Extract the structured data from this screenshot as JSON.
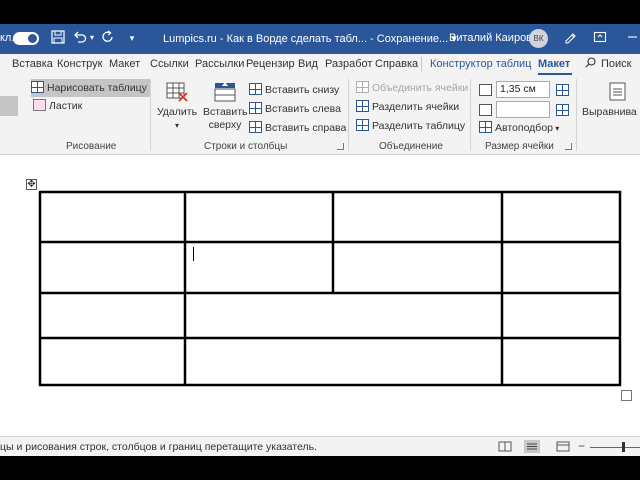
{
  "titlebar": {
    "autosave_label": "кл.",
    "doc_title": "Lumpics.ru - Как в Ворде сделать табл...  -  Сохранение... ▾",
    "user_name": "Виталий Каиров",
    "user_initials": "ВК"
  },
  "tabs": [
    "Вставка",
    "Конструк",
    "Макет",
    "Ссылки",
    "Рассылки",
    "Рецензир",
    "Вид",
    "Разработ",
    "Справка",
    "Конструктор таблиц",
    "Макет",
    "Поиск"
  ],
  "active_tab": "Макет",
  "ribbon": {
    "draw": {
      "draw_table": "Нарисовать таблицу",
      "eraser": "Ластик",
      "label": "Рисование"
    },
    "rows_cols": {
      "delete": "Удалить",
      "insert_above_1": "Вставить",
      "insert_above_2": "сверху",
      "insert_below": "Вставить снизу",
      "insert_left": "Вставить слева",
      "insert_right": "Вставить справа",
      "label": "Строки и столбцы"
    },
    "merge": {
      "merge_cells": "Объединить ячейки",
      "split_cells": "Разделить ячейки",
      "split_table": "Разделить таблицу",
      "label": "Объединение"
    },
    "cell_size": {
      "height_value": "1,35 см",
      "width_value": "",
      "autofit": "Автоподбор",
      "label": "Размер ячейки"
    },
    "alignment": {
      "label": "Выравнива"
    }
  },
  "status": {
    "text": "цы и рисования строк, столбцов и границ перетащите указатель."
  },
  "table": {
    "rows": [
      {
        "cells": [
          {
            "colspan": 1,
            "text": ""
          },
          {
            "colspan": 1,
            "text": ""
          },
          {
            "colspan": 1,
            "text": ""
          },
          {
            "colspan": 1,
            "text": ""
          }
        ]
      },
      {
        "cells": [
          {
            "colspan": 1,
            "text": ""
          },
          {
            "colspan": 1,
            "text": ""
          },
          {
            "colspan": 1,
            "text": ""
          },
          {
            "colspan": 1,
            "text": ""
          }
        ]
      },
      {
        "cells": [
          {
            "colspan": 1,
            "text": ""
          },
          {
            "colspan": 2,
            "text": ""
          },
          {
            "colspan": 1,
            "text": ""
          }
        ]
      },
      {
        "cells": [
          {
            "colspan": 1,
            "text": ""
          },
          {
            "colspan": 2,
            "text": ""
          },
          {
            "colspan": 1,
            "text": ""
          }
        ]
      }
    ]
  },
  "colors": {
    "accent": "#2b579a",
    "ribbon_bg": "#f3f3f3"
  }
}
